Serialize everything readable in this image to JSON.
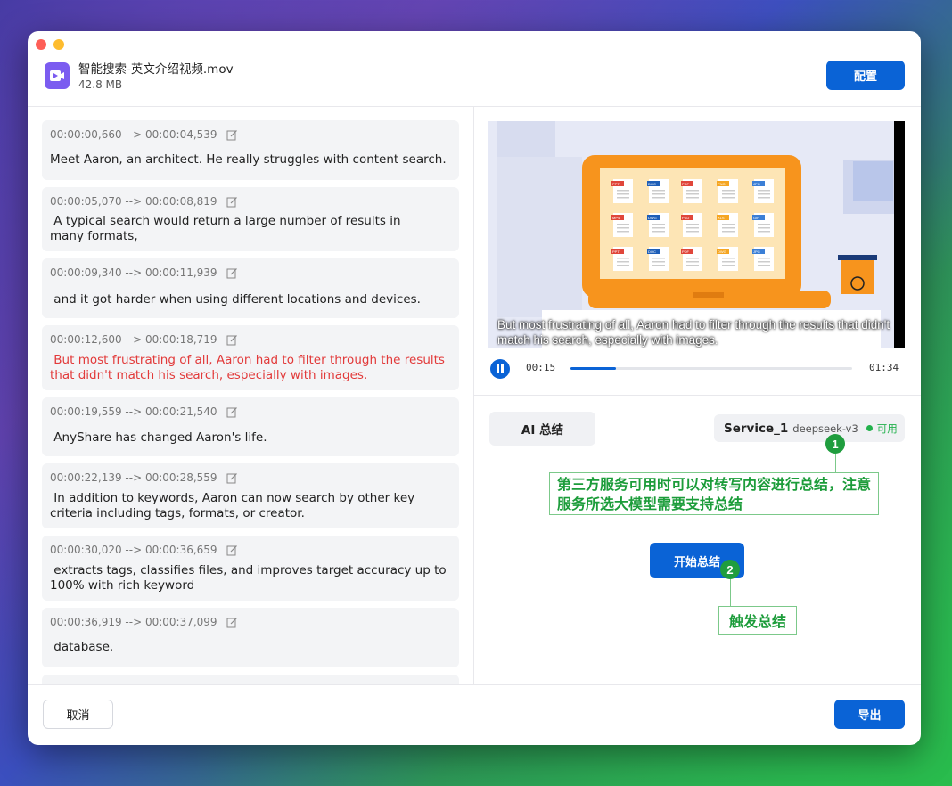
{
  "file": {
    "name": "智能搜索-英文介绍视频.mov",
    "size": "42.8 MB"
  },
  "header": {
    "config_label": "配置"
  },
  "segments": [
    {
      "time": "00:00:00,660 --> 00:00:04,539",
      "text": "Meet Aaron, an architect. He really struggles with content search.",
      "active": false
    },
    {
      "time": "00:00:05,070 --> 00:00:08,819",
      "text": " A typical search would return a large number of results in\nmany formats,",
      "active": false
    },
    {
      "time": "00:00:09,340 --> 00:00:11,939",
      "text": " and it got harder when using different locations and devices.",
      "active": false
    },
    {
      "time": "00:00:12,600 --> 00:00:18,719",
      "text": " But most frustrating of all, Aaron had to filter through the results that didn't match his search, especially with images.",
      "active": true
    },
    {
      "time": "00:00:19,559 --> 00:00:21,540",
      "text": " AnyShare has changed Aaron's life.",
      "active": false
    },
    {
      "time": "00:00:22,139 --> 00:00:28,559",
      "text": " In addition to keywords, Aaron can now search by other key criteria including tags, formats, or creator.",
      "active": false
    },
    {
      "time": "00:00:30,020 --> 00:00:36,659",
      "text": " extracts tags, classifies files, and improves target accuracy up to 100% with rich keyword",
      "active": false
    },
    {
      "time": "00:00:36,919 --> 00:00:37,099",
      "text": " database.",
      "active": false
    }
  ],
  "player": {
    "subtitle": "But most frustrating of all, Aaron had to filter through the results that didn't match his search, especially with images.",
    "current_time": "00:15",
    "duration": "01:34",
    "progress_fraction": 0.16,
    "file_tags": [
      "PPT",
      "DOC",
      "PDF",
      "PNG",
      "JPG",
      "MP4",
      "DWG",
      "PSD",
      "XLS",
      "GIF",
      "PPT",
      "DOC",
      "PDF",
      "DWG",
      "JPG"
    ]
  },
  "summary": {
    "tab_label": "AI 总结",
    "service_name": "Service_1",
    "service_model": "deepseek-v3",
    "service_status": "可用",
    "start_label": "开始总结"
  },
  "annotations": {
    "badge1": "1",
    "note1": "第三方服务可用时可以对转写内容进行总结，注意服务所选大模型需要支持总结",
    "badge2": "2",
    "note2": "触发总结"
  },
  "footer": {
    "cancel_label": "取消",
    "export_label": "导出"
  },
  "colors": {
    "primary": "#0a63d6",
    "active_text": "#e23a3a",
    "annotation": "#1f9d3e",
    "file_icon": "#7b5cf0"
  }
}
